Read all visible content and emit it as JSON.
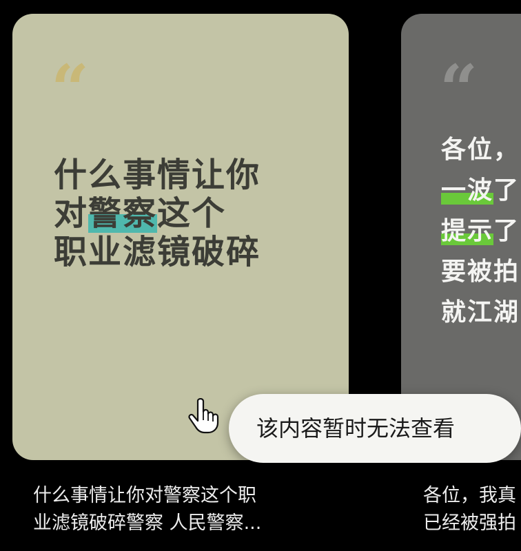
{
  "cards": [
    {
      "quote_mark": "“",
      "lines": [
        {
          "before": "什么事情让你",
          "highlight": "",
          "after": ""
        },
        {
          "before": "对",
          "highlight": "警察",
          "after": "这个"
        },
        {
          "before": "职业滤镜破碎",
          "highlight": "",
          "after": ""
        }
      ],
      "caption": [
        "什么事情让你对警察这个职",
        "业滤镜破碎警察 人民警察..."
      ],
      "colors": {
        "background": "#c3c4a6",
        "text": "#3c3d36",
        "highlight": "#4fb8ad"
      }
    },
    {
      "quote_mark": "“",
      "lines": [
        {
          "before": "各位，",
          "highlight": "",
          "after": ""
        },
        {
          "before": "",
          "highlight": "一波",
          "after": "了"
        },
        {
          "before": "",
          "highlight": "提示",
          "after": "了"
        },
        {
          "before": "要被拍",
          "highlight": "",
          "after": ""
        },
        {
          "before": "就江湖",
          "highlight": "",
          "after": ""
        }
      ],
      "caption": [
        "各位，我真",
        "已经被强拍"
      ],
      "colors": {
        "background": "#6a6a68",
        "text": "#f4f4f2",
        "highlight": "#6ac93a"
      }
    }
  ],
  "toast": {
    "message": "该内容暂时无法查看"
  },
  "cursor": {
    "icon": "hand-pointer-icon"
  }
}
